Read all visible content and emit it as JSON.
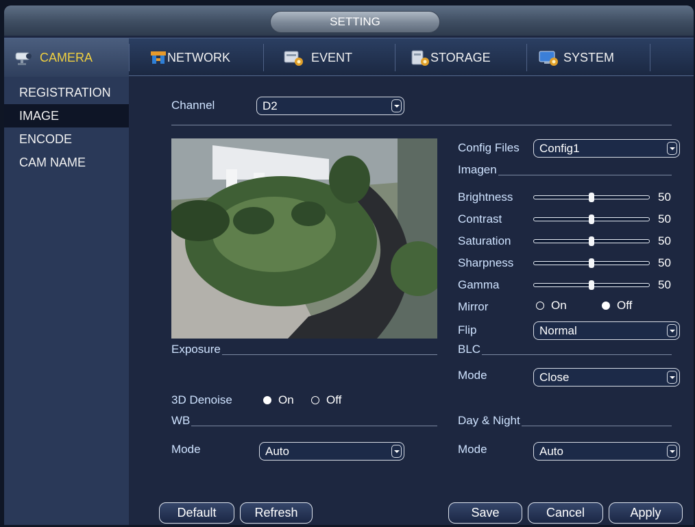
{
  "window": {
    "title": "SETTING"
  },
  "tabs": [
    {
      "label": "CAMERA",
      "icon": "camera-icon"
    },
    {
      "label": "NETWORK",
      "icon": "network-icon"
    },
    {
      "label": "EVENT",
      "icon": "event-icon"
    },
    {
      "label": "STORAGE",
      "icon": "storage-icon"
    },
    {
      "label": "SYSTEM",
      "icon": "system-icon"
    }
  ],
  "sidebar": {
    "items": [
      {
        "label": "REGISTRATION"
      },
      {
        "label": "IMAGE"
      },
      {
        "label": "ENCODE"
      },
      {
        "label": "CAM NAME"
      }
    ]
  },
  "channel": {
    "label": "Channel",
    "value": "D2"
  },
  "config_files": {
    "label": "Config Files",
    "value": "Config1"
  },
  "image_section": {
    "title": "Imagen",
    "sliders": [
      {
        "label": "Brightness",
        "value": 50
      },
      {
        "label": "Contrast",
        "value": 50
      },
      {
        "label": "Saturation",
        "value": 50
      },
      {
        "label": "Sharpness",
        "value": 50
      },
      {
        "label": "Gamma",
        "value": 50
      }
    ],
    "mirror": {
      "label": "Mirror",
      "on_label": "On",
      "off_label": "Off",
      "selected": "Off"
    },
    "flip": {
      "label": "Flip",
      "value": "Normal"
    }
  },
  "exposure": {
    "title": "Exposure"
  },
  "blc": {
    "title": "BLC",
    "mode_label": "Mode",
    "mode_value": "Close"
  },
  "denoise": {
    "label": "3D Denoise",
    "on_label": "On",
    "off_label": "Off",
    "selected": "On"
  },
  "wb": {
    "title": "WB",
    "mode_label": "Mode",
    "mode_value": "Auto"
  },
  "day_night": {
    "title": "Day & Night",
    "mode_label": "Mode",
    "mode_value": "Auto"
  },
  "buttons": {
    "default": "Default",
    "refresh": "Refresh",
    "save": "Save",
    "cancel": "Cancel",
    "apply": "Apply"
  },
  "colors": {
    "accent_active_tab": "#f0d040",
    "label_blue": "#cfe3ff",
    "background": "#1d2740"
  }
}
